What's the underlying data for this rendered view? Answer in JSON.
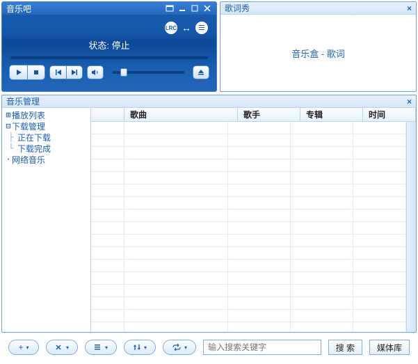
{
  "player": {
    "title": "音乐吧",
    "status_label": "状态:",
    "status_value": "停止",
    "lrc_badge": "LRC"
  },
  "lyrics": {
    "title": "歌词秀",
    "body": "音乐盒 - 歌词"
  },
  "manager": {
    "title": "音乐管理"
  },
  "tree": {
    "playlist": "播放列表",
    "download_mgr": "下载管理",
    "downloading": "正在下载",
    "download_done": "下载完成",
    "net_music": "网络音乐"
  },
  "columns": {
    "song": "歌曲",
    "singer": "歌手",
    "album": "专辑",
    "time": "时间"
  },
  "toolbar": {
    "add": "+",
    "search_placeholder": "输入搜索关键字",
    "search_btn": "搜 索",
    "media_lib": "媒体库"
  }
}
